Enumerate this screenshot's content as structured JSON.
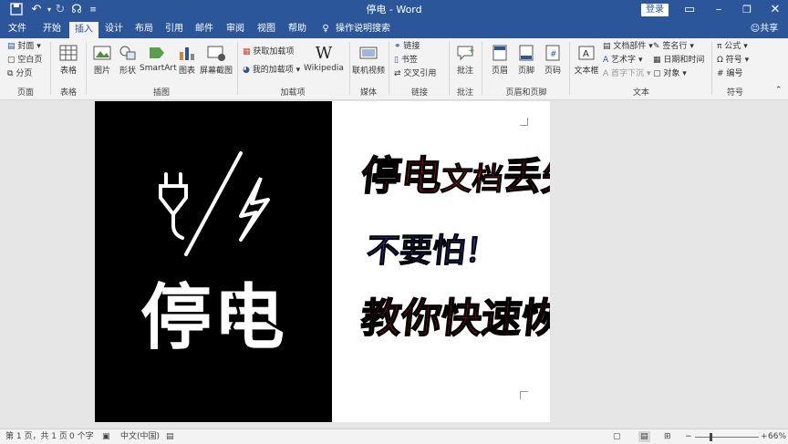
{
  "window": {
    "title": "停电 - Word",
    "login_label": "登录"
  },
  "menu": {
    "tabs": [
      "文件",
      "开始",
      "插入",
      "设计",
      "布局",
      "引用",
      "邮件",
      "审阅",
      "视图",
      "帮助"
    ],
    "active_tab": "插入",
    "search_label": "操作说明搜索",
    "share_label": "共享"
  },
  "ribbon": {
    "pages": {
      "cover": "封面",
      "blank": "空白页",
      "break": "分页",
      "group": "页面"
    },
    "tables": {
      "table": "表格",
      "group": "表格"
    },
    "illustrations": {
      "pictures": "图片",
      "shapes": "形状",
      "smartart": "SmartArt",
      "chart": "图表",
      "screenshot": "屏幕截图",
      "group": "插图"
    },
    "addins": {
      "get": "获取加载项",
      "my": "我的加载项",
      "wikipedia": "Wikipedia",
      "group": "加载项"
    },
    "media": {
      "video": "联机视频",
      "group": "媒体"
    },
    "links": {
      "link": "链接",
      "bookmark": "书签",
      "crossref": "交叉引用",
      "group": "链接"
    },
    "comments": {
      "comment": "批注",
      "group": "批注"
    },
    "header_footer": {
      "header": "页眉",
      "footer": "页脚",
      "pagenum": "页码",
      "group": "页眉和页脚"
    },
    "text": {
      "textbox": "文本框",
      "quickparts": "文档部件",
      "wordart": "艺术字",
      "dropcap": "首字下沉",
      "sigline": "签名行",
      "datetime": "日期和时间",
      "object": "对象",
      "group": "文本"
    },
    "symbols": {
      "equation": "公式",
      "symbol": "符号",
      "number": "编号",
      "group": "符号"
    }
  },
  "document": {
    "left_title": "停电",
    "line1_part1": "停电",
    "line1_part2": "文档",
    "line1_part3": "丢失",
    "line2": "不要怕！",
    "line3": "教你快速恢复！"
  },
  "status": {
    "page": "第 1 页，共 1 页",
    "words": "0 个字",
    "language": "中文(中国)",
    "zoom": "66%"
  },
  "colors": {
    "accent": "#2b579a",
    "red": "#e8141b",
    "blue": "#2b3bd6"
  }
}
